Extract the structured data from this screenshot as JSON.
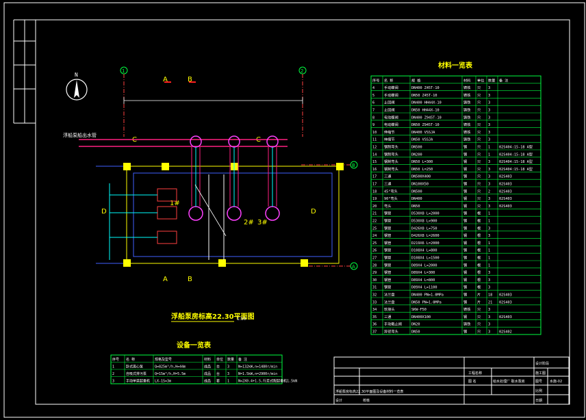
{
  "compass": {
    "label": "N"
  },
  "grid_labels": {
    "axis_1_top_left": "1",
    "axis_2_top_right": "2",
    "axis_b_right": "B",
    "axis_a_right": "A",
    "section_a": "A",
    "section_b": "B",
    "section_c": "C",
    "section_d": "D",
    "pump_1": "1#",
    "pump_2": "2#",
    "pump_3": "3#"
  },
  "plan": {
    "pipe_note": "浮船泵船出水管",
    "title": "浮船泵房标高22.30平面图",
    "scale": "1:50"
  },
  "materials": {
    "title": "材料一览表",
    "headers": [
      "序号",
      "名 称",
      "规 格",
      "材料",
      "单位",
      "数量",
      "备 注"
    ],
    "rows": [
      [
        "4",
        "手动蝶阀",
        "DN400 Z45T-10",
        "铸铁",
        "只",
        "3",
        ""
      ],
      [
        "5",
        "手动蝶阀",
        "DN50  Z45T-10",
        "铸铁",
        "只",
        "3",
        ""
      ],
      [
        "6",
        "止回阀",
        "DN400 HH44X-10",
        "铸铁",
        "只",
        "3",
        ""
      ],
      [
        "7",
        "止回阀",
        "DN50  HH44X-10",
        "铸铁",
        "只",
        "3",
        ""
      ],
      [
        "8",
        "电动蝶阀",
        "DN400 Z945T-10",
        "铸铁",
        "只",
        "3",
        ""
      ],
      [
        "9",
        "电动蝶阀",
        "DN50  Z945T-10",
        "铸铁",
        "只",
        "3",
        ""
      ],
      [
        "10",
        "伸缩节",
        "DN400 VSSJA",
        "铸铁",
        "只",
        "3",
        ""
      ],
      [
        "11",
        "伸缩节",
        "DN50  VSSJA",
        "铸铁",
        "只",
        "3",
        ""
      ],
      [
        "12",
        "钢制弯头",
        "DN500",
        "钢",
        "只",
        "1",
        "02S404:15-18 A型"
      ],
      [
        "14",
        "钢制弯头",
        "DN200",
        "钢",
        "只",
        "1",
        "02S404:15-18 A型"
      ],
      [
        "15",
        "钢制弯头",
        "DN50 L=300",
        "钢",
        "只",
        "3",
        "02S404:15-18 A型"
      ],
      [
        "16",
        "钢制弯头",
        "DN50 L=250",
        "钢",
        "只",
        "3",
        "02S404:15-18 A型"
      ],
      [
        "17",
        "三通",
        "DN500X400",
        "钢",
        "只",
        "3",
        "02S403"
      ],
      [
        "17",
        "三通",
        "DN100X50",
        "钢",
        "只",
        "3",
        "02S403"
      ],
      [
        "18",
        "45°弯头",
        "DN500",
        "钢",
        "只",
        "2",
        "02S403"
      ],
      [
        "19",
        "90°弯头",
        "DN400",
        "钢",
        "只",
        "3",
        "02S403"
      ],
      [
        "20",
        "弯头",
        "DN50",
        "钢",
        "只",
        "3",
        "02S403"
      ],
      [
        "21",
        "钢管",
        "D530X8  L=2000",
        "钢",
        "根",
        "1",
        ""
      ],
      [
        "22",
        "钢管",
        "D530X8  L=900",
        "钢",
        "根",
        "1",
        ""
      ],
      [
        "25",
        "钢管",
        "D426X8  L=750",
        "钢",
        "根",
        "3",
        ""
      ],
      [
        "24",
        "钢管",
        "D426X8  L=2600",
        "钢",
        "根",
        "3",
        ""
      ],
      [
        "25",
        "钢管",
        "D219X6  L=2000",
        "钢",
        "根",
        "1",
        ""
      ],
      [
        "26",
        "钢管",
        "D108X4  L=800",
        "钢",
        "根",
        "1",
        ""
      ],
      [
        "27",
        "钢管",
        "D108X4  L=1500",
        "钢",
        "根",
        "1",
        ""
      ],
      [
        "28",
        "钢管",
        "D89X4  L=2000",
        "钢",
        "根",
        "1",
        ""
      ],
      [
        "29",
        "钢管",
        "D89X4  L=300",
        "钢",
        "根",
        "3",
        ""
      ],
      [
        "30",
        "钢管",
        "D89X4  L=800",
        "钢",
        "根",
        "3",
        ""
      ],
      [
        "31",
        "钢管",
        "D89X4  L=1100",
        "钢",
        "根",
        "3",
        ""
      ],
      [
        "32",
        "法兰盘",
        "DN400 PN=1.0MPa",
        "钢",
        "片",
        "18",
        "02S403"
      ],
      [
        "33",
        "法兰盘",
        "DN50  PN=1.0MPa",
        "钢",
        "片",
        "21",
        "02S403"
      ],
      [
        "34",
        "软接头",
        "SKW-F50",
        "铸铁",
        "只",
        "3",
        ""
      ],
      [
        "35",
        "三通",
        "DN400X100",
        "钢",
        "只",
        "3",
        "02S403"
      ],
      [
        "36",
        "手动截止阀",
        "DN20",
        "铸铁",
        "只",
        "3",
        ""
      ],
      [
        "37",
        "异径弯头",
        "DN50",
        "钢",
        "只",
        "3",
        "02S402"
      ]
    ]
  },
  "equipment": {
    "title": "设备一览表",
    "headers": [
      "序号",
      "名 称",
      "规格及型号",
      "材料",
      "单位",
      "数量",
      "备 注"
    ],
    "rows": [
      [
        "1",
        "卧式离心泵",
        "Q=825m³/h,H=44m",
        "成品",
        "台",
        "3",
        "N=132kW,n=1480r/min"
      ],
      [
        "2",
        "自吸式排污泵",
        "Q=15m³/h,H=5.5m",
        "成品",
        "台",
        "3",
        "N=1.5kW,n=2900r/min"
      ],
      [
        "3",
        "手动单梁起重机",
        "LX-1S=3m",
        "成品",
        "套",
        "1",
        "N=2X0.4+1.5,行走式配起重机1.5kN"
      ]
    ]
  },
  "title_block": {
    "project_label": "工程名称",
    "drawing_label": "图 名",
    "sub_project": "给水处理厂 取水泵房",
    "drawing_name": "浮船泵房标高22.30平面图及设备材料一览表",
    "design_stage_label": "设计阶段",
    "design_stage": "施工图",
    "drawing_no_label": "图号",
    "drawing_no": "水施-02",
    "scale_label": "比例",
    "date_label": "日期",
    "designer_label": "设计",
    "checker_label": "校核"
  },
  "colors": {
    "frame": "#ffffff",
    "table": "#00ff40",
    "title": "#ffff00",
    "pipe": "#ff2080",
    "structure": "#4060ff",
    "axis": "#ff4040",
    "magenta": "#ff40ff",
    "cyan": "#00ffff",
    "yellow_block": "#ffff00"
  }
}
